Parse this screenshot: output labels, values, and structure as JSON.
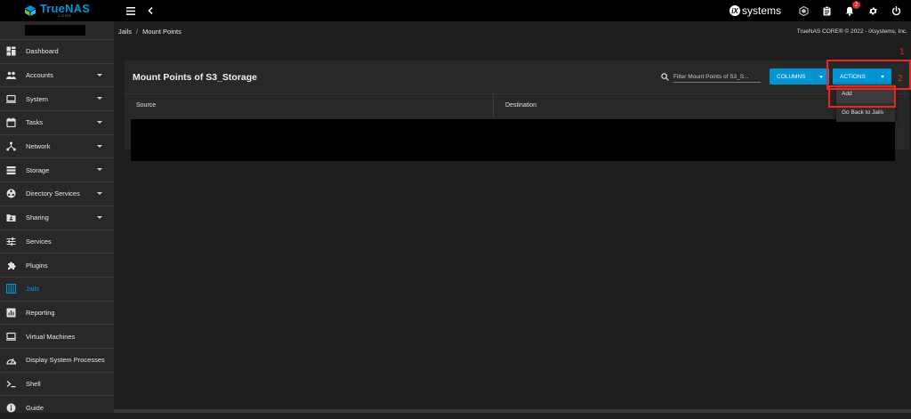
{
  "brand": {
    "name": "TrueNAS",
    "sub": "CORE",
    "vendor": "systems",
    "vendor_mark": "iX",
    "accent": "#0095d5"
  },
  "topbar": {
    "notification_count": "2",
    "icons": [
      "menu-icon",
      "chevron-left-icon",
      "truecommand-icon",
      "clipboard-icon",
      "bell-icon",
      "gear-icon",
      "power-icon"
    ]
  },
  "breadcrumb": {
    "items": [
      "Jails",
      "Mount Points"
    ],
    "copyright": "TrueNAS CORE® © 2022 - iXsystems, Inc."
  },
  "sidebar": {
    "items": [
      {
        "label": "Dashboard",
        "icon": "dashboard-icon",
        "caret": false
      },
      {
        "label": "Accounts",
        "icon": "accounts-icon",
        "caret": true
      },
      {
        "label": "System",
        "icon": "system-icon",
        "caret": true
      },
      {
        "label": "Tasks",
        "icon": "calendar-icon",
        "caret": true
      },
      {
        "label": "Network",
        "icon": "network-icon",
        "caret": true
      },
      {
        "label": "Storage",
        "icon": "storage-icon",
        "caret": true
      },
      {
        "label": "Directory Services",
        "icon": "directory-icon",
        "caret": true
      },
      {
        "label": "Sharing",
        "icon": "folder-share-icon",
        "caret": true
      },
      {
        "label": "Services",
        "icon": "sliders-icon",
        "caret": false
      },
      {
        "label": "Plugins",
        "icon": "puzzle-icon",
        "caret": false
      },
      {
        "label": "Jails",
        "icon": "jail-icon",
        "caret": false,
        "active": true
      },
      {
        "label": "Reporting",
        "icon": "chart-icon",
        "caret": false
      },
      {
        "label": "Virtual Machines",
        "icon": "laptop-icon",
        "caret": false
      },
      {
        "label": "Display System Processes",
        "icon": "gauge-icon",
        "caret": false
      },
      {
        "label": "Shell",
        "icon": "terminal-icon",
        "caret": false
      },
      {
        "label": "Guide",
        "icon": "info-icon",
        "caret": false
      }
    ]
  },
  "card": {
    "title": "Mount Points of S3_Storage",
    "filter_placeholder": "Filter Mount Points of S3_S...",
    "columns_label": "COLUMNS",
    "actions_label": "ACTIONS",
    "headers": [
      "Source",
      "Destination"
    ]
  },
  "actions_menu": {
    "items": [
      "Add",
      "Go Back to Jails"
    ]
  },
  "annotations": {
    "labels": [
      "1",
      "2"
    ],
    "color": "#e8281e"
  }
}
